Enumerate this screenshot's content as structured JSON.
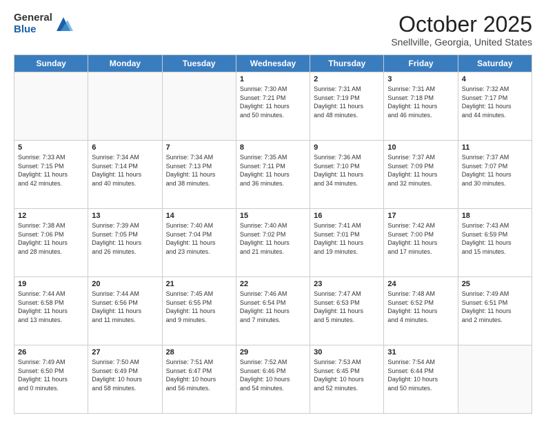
{
  "logo": {
    "general": "General",
    "blue": "Blue"
  },
  "header": {
    "month": "October 2025",
    "location": "Snellville, Georgia, United States"
  },
  "days_of_week": [
    "Sunday",
    "Monday",
    "Tuesday",
    "Wednesday",
    "Thursday",
    "Friday",
    "Saturday"
  ],
  "weeks": [
    [
      {
        "day": "",
        "info": ""
      },
      {
        "day": "",
        "info": ""
      },
      {
        "day": "",
        "info": ""
      },
      {
        "day": "1",
        "info": "Sunrise: 7:30 AM\nSunset: 7:21 PM\nDaylight: 11 hours\nand 50 minutes."
      },
      {
        "day": "2",
        "info": "Sunrise: 7:31 AM\nSunset: 7:19 PM\nDaylight: 11 hours\nand 48 minutes."
      },
      {
        "day": "3",
        "info": "Sunrise: 7:31 AM\nSunset: 7:18 PM\nDaylight: 11 hours\nand 46 minutes."
      },
      {
        "day": "4",
        "info": "Sunrise: 7:32 AM\nSunset: 7:17 PM\nDaylight: 11 hours\nand 44 minutes."
      }
    ],
    [
      {
        "day": "5",
        "info": "Sunrise: 7:33 AM\nSunset: 7:15 PM\nDaylight: 11 hours\nand 42 minutes."
      },
      {
        "day": "6",
        "info": "Sunrise: 7:34 AM\nSunset: 7:14 PM\nDaylight: 11 hours\nand 40 minutes."
      },
      {
        "day": "7",
        "info": "Sunrise: 7:34 AM\nSunset: 7:13 PM\nDaylight: 11 hours\nand 38 minutes."
      },
      {
        "day": "8",
        "info": "Sunrise: 7:35 AM\nSunset: 7:11 PM\nDaylight: 11 hours\nand 36 minutes."
      },
      {
        "day": "9",
        "info": "Sunrise: 7:36 AM\nSunset: 7:10 PM\nDaylight: 11 hours\nand 34 minutes."
      },
      {
        "day": "10",
        "info": "Sunrise: 7:37 AM\nSunset: 7:09 PM\nDaylight: 11 hours\nand 32 minutes."
      },
      {
        "day": "11",
        "info": "Sunrise: 7:37 AM\nSunset: 7:07 PM\nDaylight: 11 hours\nand 30 minutes."
      }
    ],
    [
      {
        "day": "12",
        "info": "Sunrise: 7:38 AM\nSunset: 7:06 PM\nDaylight: 11 hours\nand 28 minutes."
      },
      {
        "day": "13",
        "info": "Sunrise: 7:39 AM\nSunset: 7:05 PM\nDaylight: 11 hours\nand 26 minutes."
      },
      {
        "day": "14",
        "info": "Sunrise: 7:40 AM\nSunset: 7:04 PM\nDaylight: 11 hours\nand 23 minutes."
      },
      {
        "day": "15",
        "info": "Sunrise: 7:40 AM\nSunset: 7:02 PM\nDaylight: 11 hours\nand 21 minutes."
      },
      {
        "day": "16",
        "info": "Sunrise: 7:41 AM\nSunset: 7:01 PM\nDaylight: 11 hours\nand 19 minutes."
      },
      {
        "day": "17",
        "info": "Sunrise: 7:42 AM\nSunset: 7:00 PM\nDaylight: 11 hours\nand 17 minutes."
      },
      {
        "day": "18",
        "info": "Sunrise: 7:43 AM\nSunset: 6:59 PM\nDaylight: 11 hours\nand 15 minutes."
      }
    ],
    [
      {
        "day": "19",
        "info": "Sunrise: 7:44 AM\nSunset: 6:58 PM\nDaylight: 11 hours\nand 13 minutes."
      },
      {
        "day": "20",
        "info": "Sunrise: 7:44 AM\nSunset: 6:56 PM\nDaylight: 11 hours\nand 11 minutes."
      },
      {
        "day": "21",
        "info": "Sunrise: 7:45 AM\nSunset: 6:55 PM\nDaylight: 11 hours\nand 9 minutes."
      },
      {
        "day": "22",
        "info": "Sunrise: 7:46 AM\nSunset: 6:54 PM\nDaylight: 11 hours\nand 7 minutes."
      },
      {
        "day": "23",
        "info": "Sunrise: 7:47 AM\nSunset: 6:53 PM\nDaylight: 11 hours\nand 5 minutes."
      },
      {
        "day": "24",
        "info": "Sunrise: 7:48 AM\nSunset: 6:52 PM\nDaylight: 11 hours\nand 4 minutes."
      },
      {
        "day": "25",
        "info": "Sunrise: 7:49 AM\nSunset: 6:51 PM\nDaylight: 11 hours\nand 2 minutes."
      }
    ],
    [
      {
        "day": "26",
        "info": "Sunrise: 7:49 AM\nSunset: 6:50 PM\nDaylight: 11 hours\nand 0 minutes."
      },
      {
        "day": "27",
        "info": "Sunrise: 7:50 AM\nSunset: 6:49 PM\nDaylight: 10 hours\nand 58 minutes."
      },
      {
        "day": "28",
        "info": "Sunrise: 7:51 AM\nSunset: 6:47 PM\nDaylight: 10 hours\nand 56 minutes."
      },
      {
        "day": "29",
        "info": "Sunrise: 7:52 AM\nSunset: 6:46 PM\nDaylight: 10 hours\nand 54 minutes."
      },
      {
        "day": "30",
        "info": "Sunrise: 7:53 AM\nSunset: 6:45 PM\nDaylight: 10 hours\nand 52 minutes."
      },
      {
        "day": "31",
        "info": "Sunrise: 7:54 AM\nSunset: 6:44 PM\nDaylight: 10 hours\nand 50 minutes."
      },
      {
        "day": "",
        "info": ""
      }
    ]
  ]
}
